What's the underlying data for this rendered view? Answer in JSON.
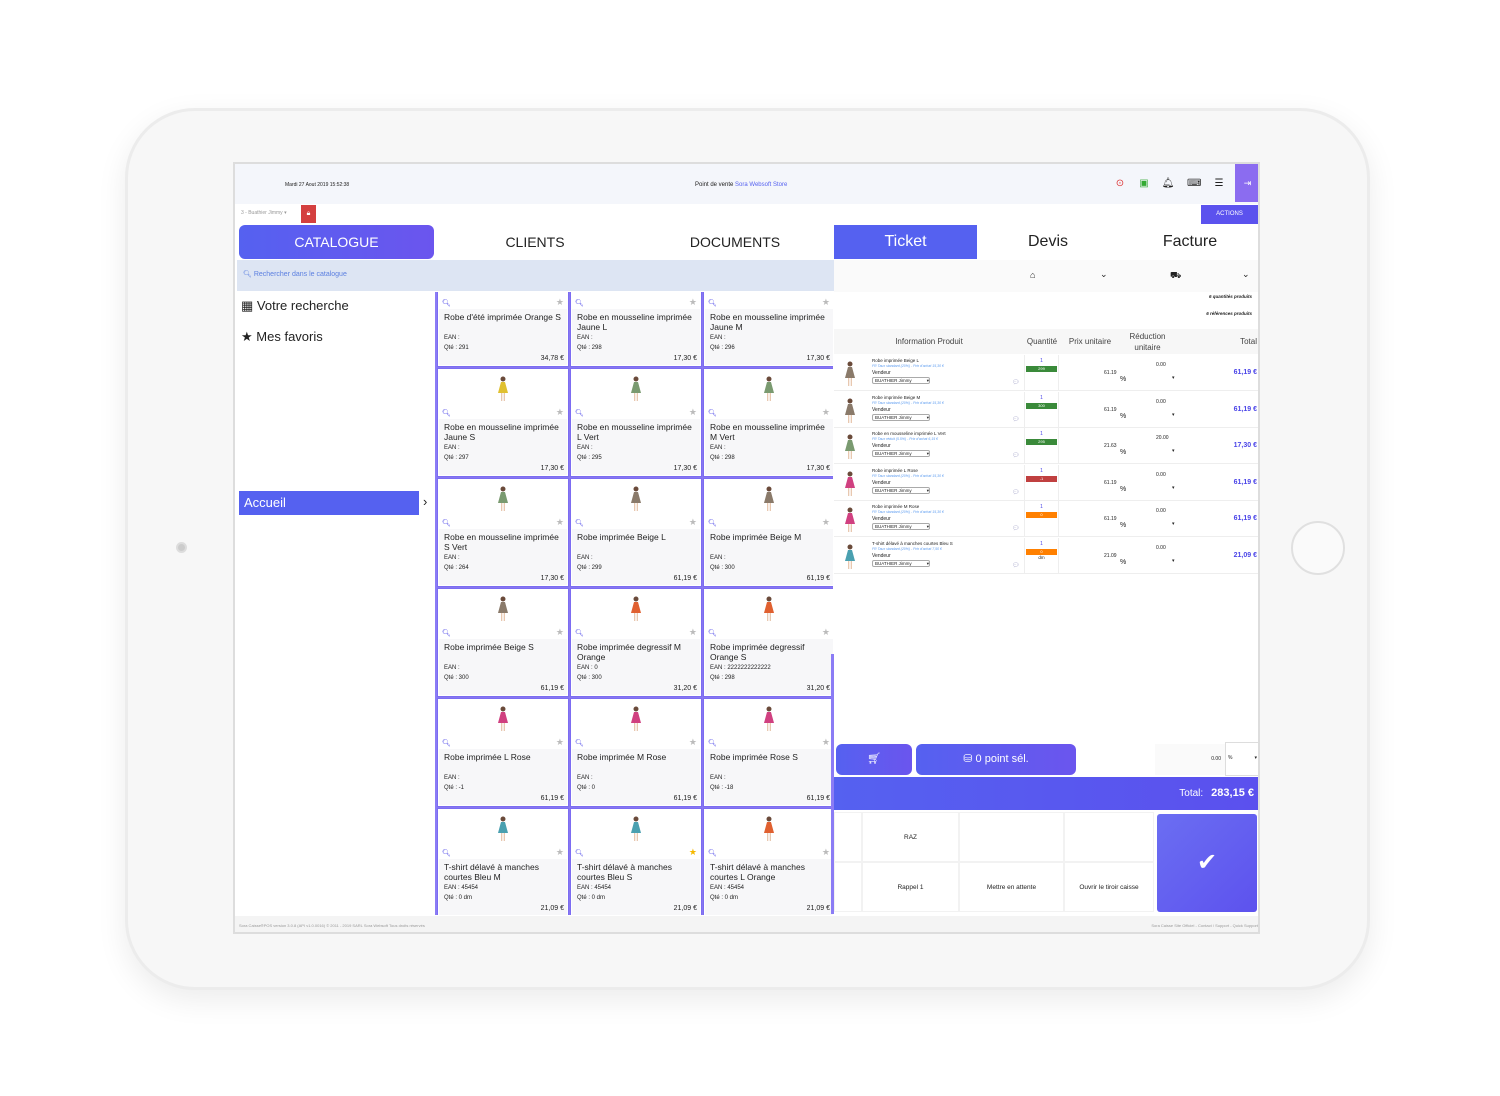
{
  "header": {
    "date": "Mardi 27 Aout 2019 15:52:38",
    "pos_label": "Point de vente",
    "store": "Sora Websoft Store",
    "user": "3 - Buathier Jimmy",
    "actions": "ACTIONS"
  },
  "colors": {
    "accent": "#5561f0",
    "lock": "#d43f3f",
    "stock_ok": "#3a8a3a",
    "stock_neg": "#c04040",
    "stock_zero": "#ff8000"
  },
  "left_tabs": [
    "CATALOGUE",
    "CLIENTS",
    "DOCUMENTS"
  ],
  "right_tabs": [
    "Ticket",
    "Devis",
    "Facture"
  ],
  "search": {
    "placeholder": "Rechercher dans le catalogue"
  },
  "sidebar": {
    "items": [
      "Votre recherche",
      "Mes favoris"
    ],
    "home": "Accueil"
  },
  "products": [
    {
      "name": "Robe d'été imprimée Orange S",
      "ean": "EAN :",
      "qte": "Qté : 291",
      "price": "34,78 €",
      "color": "#e07040",
      "fav": false
    },
    {
      "name": "Robe en mousseline imprimée Jaune L",
      "ean": "EAN :",
      "qte": "Qté : 298",
      "price": "17,30 €",
      "color": "#e0c030",
      "fav": false
    },
    {
      "name": "Robe en mousseline imprimée Jaune M",
      "ean": "EAN :",
      "qte": "Qté : 296",
      "price": "17,30 €",
      "color": "#e0c030",
      "fav": false
    },
    {
      "name": "Robe en mousseline imprimée Jaune S",
      "ean": "EAN :",
      "qte": "Qté : 297",
      "price": "17,30 €",
      "color": "#e0c030",
      "fav": false
    },
    {
      "name": "Robe en mousseline imprimée L Vert",
      "ean": "EAN :",
      "qte": "Qté : 295",
      "price": "17,30 €",
      "color": "#7a9a70",
      "fav": false
    },
    {
      "name": "Robe en mousseline imprimée M Vert",
      "ean": "EAN :",
      "qte": "Qté : 298",
      "price": "17,30 €",
      "color": "#7a9a70",
      "fav": false
    },
    {
      "name": "Robe en mousseline imprimée S Vert",
      "ean": "EAN :",
      "qte": "Qté : 264",
      "price": "17,30 €",
      "color": "#7a9a70",
      "fav": false
    },
    {
      "name": "Robe imprimée Beige L",
      "ean": "EAN :",
      "qte": "Qté : 299",
      "price": "61,19 €",
      "color": "#8a7a6a",
      "fav": false
    },
    {
      "name": "Robe imprimée Beige M",
      "ean": "EAN :",
      "qte": "Qté : 300",
      "price": "61,19 €",
      "color": "#8a7a6a",
      "fav": false
    },
    {
      "name": "Robe imprimée Beige S",
      "ean": "EAN :",
      "qte": "Qté : 300",
      "price": "61,19 €",
      "color": "#8a7a6a",
      "fav": false
    },
    {
      "name": "Robe imprimée degressif M Orange",
      "ean": "EAN : 0",
      "qte": "Qté : 300",
      "price": "31,20 €",
      "color": "#e06030",
      "fav": false
    },
    {
      "name": "Robe imprimée degressif Orange S",
      "ean": "EAN : 2222222222222",
      "qte": "Qté : 298",
      "price": "31,20 €",
      "color": "#e06030",
      "fav": false
    },
    {
      "name": "Robe imprimée L Rose",
      "ean": "EAN :",
      "qte": "Qté : -1",
      "price": "61,19 €",
      "color": "#d04080",
      "fav": false
    },
    {
      "name": "Robe imprimée M Rose",
      "ean": "EAN :",
      "qte": "Qté : 0",
      "price": "61,19 €",
      "color": "#d04080",
      "fav": false
    },
    {
      "name": "Robe imprimée Rose S",
      "ean": "EAN :",
      "qte": "Qté : -18",
      "price": "61,19 €",
      "color": "#d04080",
      "fav": false
    },
    {
      "name": "T-shirt délavé à manches courtes Bleu M",
      "ean": "EAN : 45454",
      "qte": "Qté : 0 dm",
      "price": "21,09 €",
      "color": "#4aa0b0",
      "fav": false
    },
    {
      "name": "T-shirt délavé à manches courtes Bleu S",
      "ean": "EAN : 45454",
      "qte": "Qté : 0 dm",
      "price": "21,09 €",
      "color": "#4aa0b0",
      "fav": true
    },
    {
      "name": "T-shirt délavé à manches courtes L Orange",
      "ean": "EAN : 45454",
      "qte": "Qté : 0 dm",
      "price": "21,09 €",
      "color": "#e06030",
      "fav": false
    }
  ],
  "ticket": {
    "counts": [
      "6  quantités produits",
      "6  références produits"
    ],
    "columns": [
      "Information Produit",
      "Quantité",
      "Prix unitaire",
      "Réduction unitaire",
      "Total"
    ],
    "vendor_label": "Vendeur",
    "rows": [
      {
        "name": "Robe imprimée Beige L",
        "tax": "FR Taux standard (20%) - Prix d'achat 15,30 €",
        "vendor": "BUATHIER Jimmy",
        "qty": "1",
        "stock": "299",
        "stock_status": "ok",
        "unit": "dm",
        "price": "61.19",
        "pct": "%",
        "discount": "0.00",
        "total": "61,19 €",
        "color": "#8a7a6a"
      },
      {
        "name": "Robe imprimée Beige M",
        "tax": "FR Taux standard (20%) - Prix d'achat 15,30 €",
        "vendor": "BUATHIER Jimmy",
        "qty": "1",
        "stock": "300",
        "stock_status": "ok",
        "price": "61.19",
        "pct": "%",
        "discount": "0.00",
        "total": "61,19 €",
        "color": "#8a7a6a"
      },
      {
        "name": "Robe en mousseline imprimée L Vert",
        "tax": "FR Taux réduit (5.5%) - Prix d'achat 6,15 €",
        "vendor": "BUATHIER Jimmy",
        "qty": "1",
        "stock": "295",
        "stock_status": "ok",
        "price": "21.63",
        "pct": "%",
        "discount": "20.00",
        "total": "17,30 €",
        "color": "#7a9a70"
      },
      {
        "name": "Robe imprimée L Rose",
        "tax": "FR Taux standard (20%) - Prix d'achat 15,30 €",
        "vendor": "BUATHIER Jimmy",
        "qty": "1",
        "stock": "-1",
        "stock_status": "neg",
        "price": "61.19",
        "pct": "%",
        "discount": "0.00",
        "total": "61,19 €",
        "color": "#d04080"
      },
      {
        "name": "Robe imprimée M Rose",
        "tax": "FR Taux standard (20%) - Prix d'achat 15,30 €",
        "vendor": "BUATHIER Jimmy",
        "qty": "1",
        "stock": "0",
        "stock_status": "zero",
        "price": "61.19",
        "pct": "%",
        "discount": "0.00",
        "total": "61,19 €",
        "color": "#d04080"
      },
      {
        "name": "T-shirt délavé à manches courtes Bleu S",
        "tax": "FR Taux standard (20%) - Prix d'achat 7,50 €",
        "vendor": "BUATHIER Jimmy",
        "qty": "1",
        "stock": "0",
        "stock_status": "zero",
        "unit": "dm",
        "price": "21.09",
        "pct": "%",
        "discount": "0.00",
        "total": "21,09 €",
        "color": "#4aa0b0"
      }
    ],
    "points": "0 point sél.",
    "global_discount": "0.00",
    "global_discount_unit": "%",
    "total_label": "Total:",
    "total": "283,15 €",
    "actions": [
      "RAZ",
      "Rappel 1",
      "Mettre en attente",
      "Ouvrir le tiroir caisse"
    ]
  },
  "footer": {
    "left": "Sora Caisse®POS version 3.0.8 (API v1.0.0016) © 2011 - 2019 SARL Sora Websoft Tous droits réservés",
    "right": "Sora Caisse Site Officiel - Contact / Support - Quick Support"
  }
}
